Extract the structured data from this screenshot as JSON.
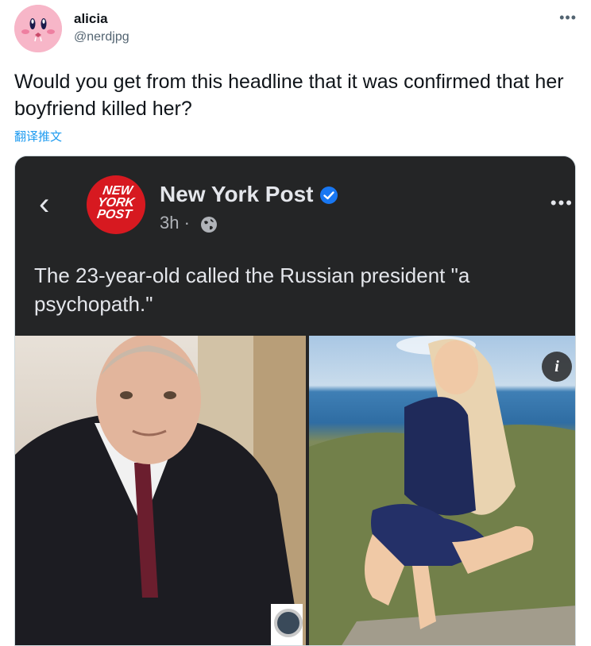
{
  "tweet": {
    "author_name": "alicia",
    "author_handle": "@nerdjpg",
    "more_label": "•••",
    "text": "Would you get from this headline that it was confirmed that her boyfriend killed her?",
    "translate_label": "翻译推文"
  },
  "embedded_post": {
    "back_icon": "‹",
    "logo_text": [
      "NEW",
      "YORK",
      "POST"
    ],
    "page_name": "New York Post",
    "time": "3h ·",
    "more_label": "•••",
    "caption": "The 23-year-old called the Russian president \"a psychopath.\"",
    "info_label": "i",
    "colors": {
      "background": "#242526",
      "logo_red": "#d71920",
      "verified_blue": "#1877f2",
      "link_blue": "#1d9bf0"
    }
  }
}
